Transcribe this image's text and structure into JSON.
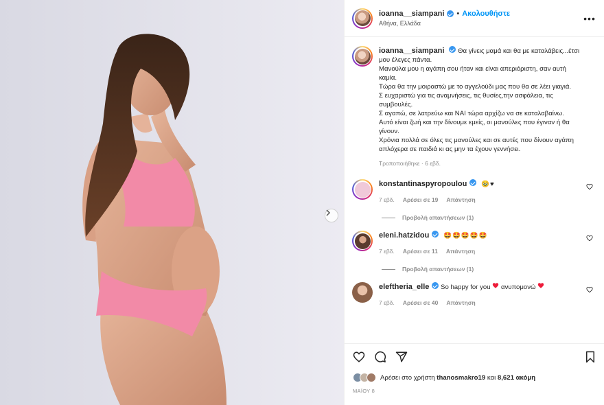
{
  "post": {
    "author": "ioanna__siampani",
    "follow_label": "Ακολουθήστε",
    "separator": "•",
    "location": "Αθήνα, Ελλάδα",
    "more_label": "•••",
    "caption_lines": [
      "Θα γίνεις μαμά και θα με καταλάβεις...έτσι μου έλεγες πάντα.",
      "Μανούλα μου η αγάπη σου ήταν και είναι απεριόριστη, σαν αυτή καμία.",
      "Τώρα θα την μοιραστώ με το αγγελούδι μας που θα σε λέει γιαγιά.",
      "Σ ευχαριστώ για τις αναμνήσεις, τις θυσίες,την ασφάλεια, τις συμβουλές.",
      "Σ αγαπώ, σε λατρεύω και ΝΑΙ τώρα αρχίζω να σε καταλαβαίνω.",
      "Αυτό είναι ζωή και την δίνουμε εμείς, οι μανούλες που έγιναν ή θα γίνουν.",
      "Χρόνια πολλά σε όλες τις μανούλες και σε αυτές που δίνουν αγάπη απλόχερα σε παιδιά κι ας μην τα έχουν γεννήσει."
    ],
    "edited": "Τροποποιήθηκε · 6 εβδ."
  },
  "comments": [
    {
      "user": "konstantinaspyropoulou",
      "text": "🥹♥",
      "age": "7 εβδ.",
      "likes": "Αρέσει σε 19",
      "reply": "Απάντηση",
      "view_replies": "Προβολή απαντήσεων (1)",
      "avatar_color": "#f0c9d9"
    },
    {
      "user": "eleni.hatzidou",
      "text": "🤩🤩🤩🤩🤩",
      "age": "7 εβδ.",
      "likes": "Αρέσει σε 11",
      "reply": "Απάντηση",
      "view_replies": "Προβολή απαντήσεων (1)",
      "avatar_color": "#5a3b2e"
    },
    {
      "user": "eleftheria_elle",
      "text_before": "So happy for you",
      "text_after": "ανυπομονώ",
      "age": "7 εβδ.",
      "likes": "Αρέσει σε 40",
      "reply": "Απάντηση",
      "avatar_color": "#c89a7c"
    }
  ],
  "footer": {
    "likes_prefix": "Αρέσει στο χρήστη",
    "liked_by": "thanosmakro19",
    "likes_and": "και",
    "likes_count": "8,621 ακόμη",
    "date": "ΜΑΪΟΥ 8"
  },
  "colors": {
    "link_blue": "#0095f6",
    "verified_blue": "#3897f0",
    "heart_red": "#ed1c3a",
    "bikini_pink": "#f28aa7"
  }
}
